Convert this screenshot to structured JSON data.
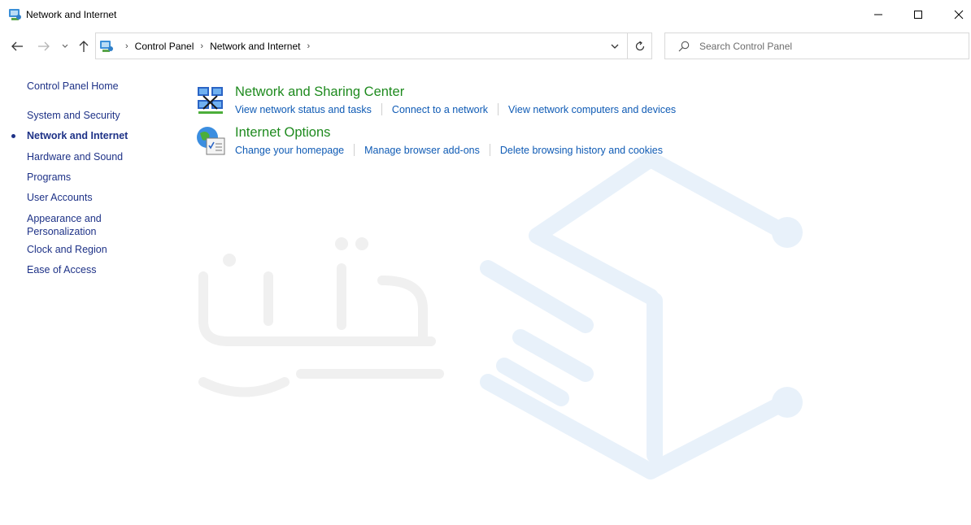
{
  "window": {
    "title": "Network and Internet",
    "controls": {
      "minimize": "minimize",
      "maximize": "maximize",
      "close": "close"
    }
  },
  "nav": {
    "breadcrumbs": [
      "Control Panel",
      "Network and Internet"
    ]
  },
  "search": {
    "placeholder": "Search Control Panel",
    "value": ""
  },
  "sidebar": {
    "home": "Control Panel Home",
    "items": [
      {
        "label": "System and Security",
        "active": false
      },
      {
        "label": "Network and Internet",
        "active": true
      },
      {
        "label": "Hardware and Sound",
        "active": false
      },
      {
        "label": "Programs",
        "active": false
      },
      {
        "label": "User Accounts",
        "active": false
      },
      {
        "label": "Appearance and",
        "label2": "Personalization",
        "active": false
      },
      {
        "label": "Clock and Region",
        "active": false
      },
      {
        "label": "Ease of Access",
        "active": false
      }
    ]
  },
  "categories": [
    {
      "title": "Network and Sharing Center",
      "icon": "network-sharing-icon",
      "links": [
        "View network status and tasks",
        "Connect to a network",
        "View network computers and devices"
      ]
    },
    {
      "title": "Internet Options",
      "icon": "internet-options-icon",
      "links": [
        "Change your homepage",
        "Manage browser add-ons",
        "Delete browsing history and cookies"
      ]
    }
  ],
  "colors": {
    "link": "#0f5bb5",
    "category_title": "#1e8a1e",
    "sidebar_link": "#1e3287",
    "watermark": "#e3eef9"
  }
}
